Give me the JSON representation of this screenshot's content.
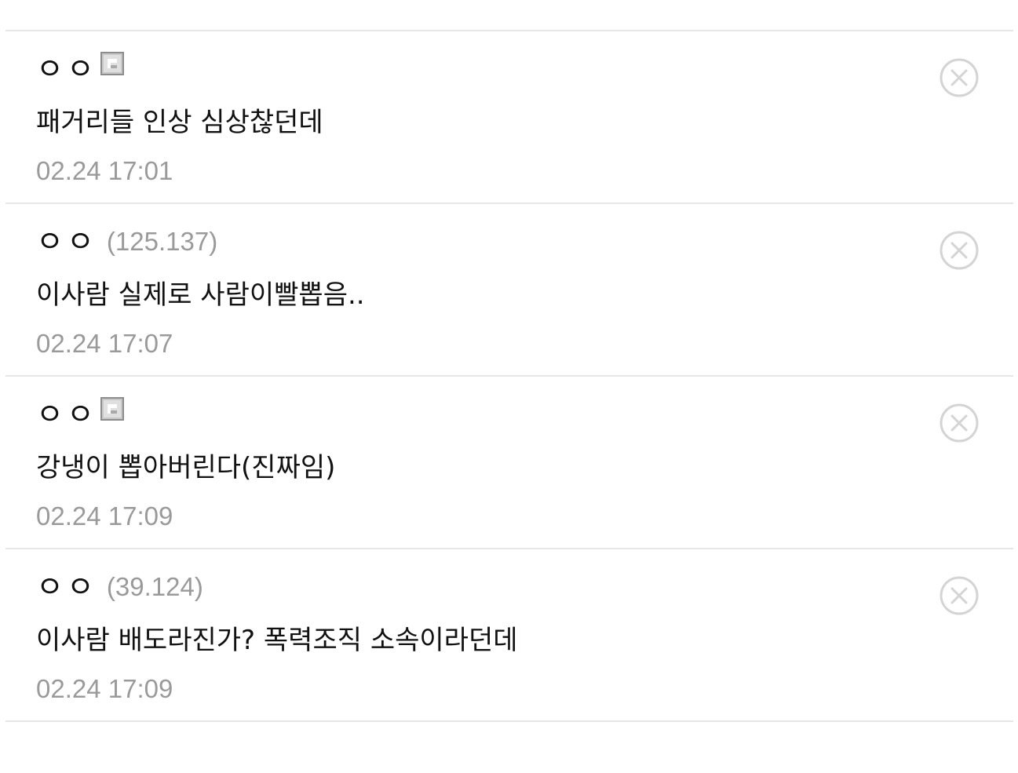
{
  "comments": [
    {
      "author": "ㅇㅇ",
      "fixed_icon": true,
      "ip": "",
      "text": "패거리들 인상 심상찮던데",
      "time": "02.24 17:01"
    },
    {
      "author": "ㅇㅇ",
      "fixed_icon": false,
      "ip": "(125.137)",
      "text": "이사람 실제로 사람이빨뽑음..",
      "time": "02.24 17:07"
    },
    {
      "author": "ㅇㅇ",
      "fixed_icon": true,
      "ip": "",
      "text": "강냉이 뽑아버린다(진짜임)",
      "time": "02.24 17:09"
    },
    {
      "author": "ㅇㅇ",
      "fixed_icon": false,
      "ip": "(39.124)",
      "text": "이사람 배도라진가? 폭력조직 소속이라던데",
      "time": "02.24 17:09"
    }
  ],
  "icons": {
    "fixed_nick": "fixed-nickname-icon",
    "delete": "circle-x-icon"
  },
  "colors": {
    "text": "#111111",
    "meta": "#9a9a9a",
    "divider": "#e6e6e6",
    "delete_icon": "#d4d4d4"
  }
}
